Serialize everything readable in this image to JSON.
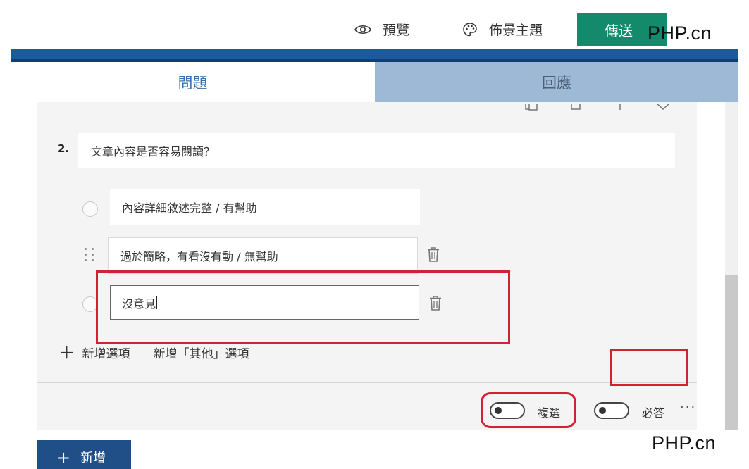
{
  "header": {
    "preview_label": "預覽",
    "theme_label": "佈景主題",
    "send_label": "傳送"
  },
  "watermarks": [
    "PHP.cn",
    "PHP.cn"
  ],
  "tabs": [
    {
      "label": "問題",
      "active": true
    },
    {
      "label": "回應",
      "active": false
    }
  ],
  "question": {
    "number": "2.",
    "title": "文章內容是否容易閱讀？",
    "options": [
      "內容詳細敘述完整 / 有幫助",
      "過於簡略，有看沒有動 / 無幫助",
      "沒意見"
    ],
    "add_option_label": "新增選項",
    "add_other_label": "新增「其他」選項",
    "multiple_choice_label": "複選",
    "required_label": "必答",
    "more_label": "···"
  },
  "new_button_label": "新增",
  "colors": {
    "accent": "#1c5a9a",
    "send_button": "#138a6c",
    "tab_inactive": "#9db9d6",
    "highlight": "#cf2232"
  },
  "icons": [
    "eye-icon",
    "palette-icon",
    "copy-icon",
    "delete-icon",
    "move-icon",
    "drag-handle-icon",
    "trash-icon",
    "plus-icon"
  ]
}
